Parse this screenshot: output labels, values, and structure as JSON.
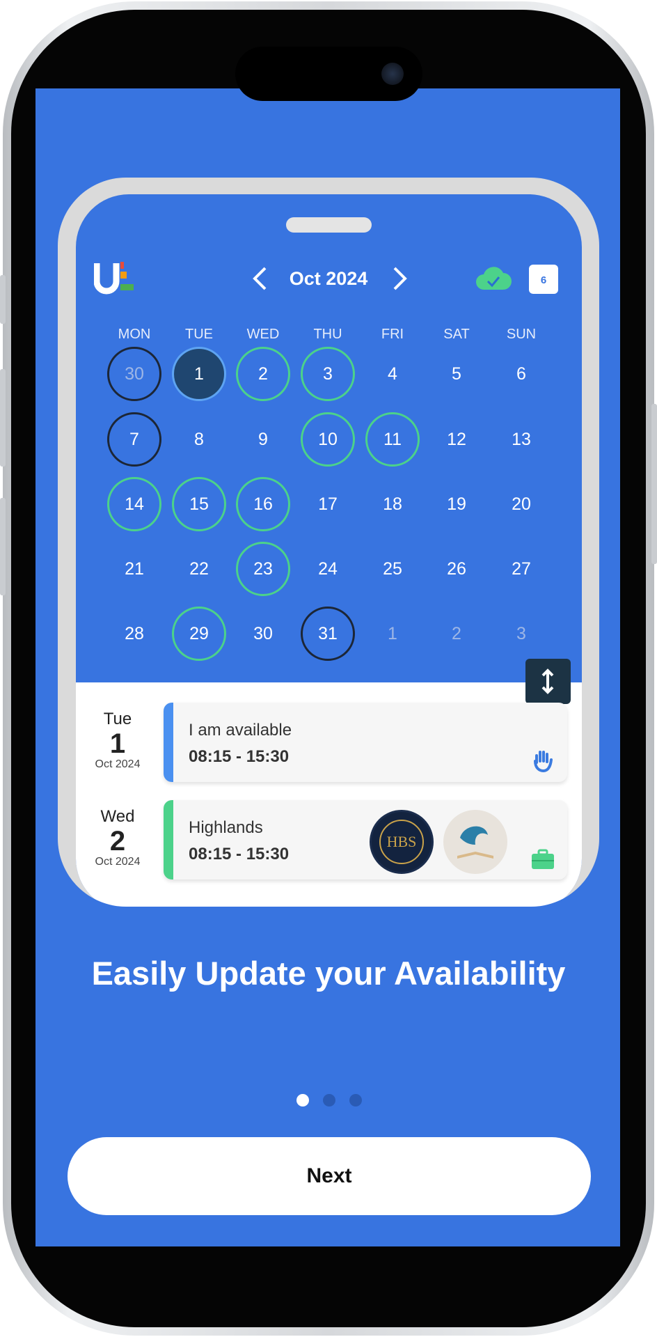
{
  "header": {
    "month": "Oct 2024",
    "calendar_badge": "6"
  },
  "weekdays": [
    "MON",
    "TUE",
    "WED",
    "THU",
    "FRI",
    "SAT",
    "SUN"
  ],
  "weeks": [
    [
      {
        "d": "30",
        "s": "out dark"
      },
      {
        "d": "1",
        "s": "today"
      },
      {
        "d": "2",
        "s": "green"
      },
      {
        "d": "3",
        "s": "green"
      },
      {
        "d": "4",
        "s": ""
      },
      {
        "d": "5",
        "s": ""
      },
      {
        "d": "6",
        "s": ""
      }
    ],
    [
      {
        "d": "7",
        "s": "dark"
      },
      {
        "d": "8",
        "s": ""
      },
      {
        "d": "9",
        "s": ""
      },
      {
        "d": "10",
        "s": "green"
      },
      {
        "d": "11",
        "s": "green"
      },
      {
        "d": "12",
        "s": ""
      },
      {
        "d": "13",
        "s": ""
      }
    ],
    [
      {
        "d": "14",
        "s": "green"
      },
      {
        "d": "15",
        "s": "green"
      },
      {
        "d": "16",
        "s": "green"
      },
      {
        "d": "17",
        "s": ""
      },
      {
        "d": "18",
        "s": ""
      },
      {
        "d": "19",
        "s": ""
      },
      {
        "d": "20",
        "s": ""
      }
    ],
    [
      {
        "d": "21",
        "s": ""
      },
      {
        "d": "22",
        "s": ""
      },
      {
        "d": "23",
        "s": "green"
      },
      {
        "d": "24",
        "s": ""
      },
      {
        "d": "25",
        "s": ""
      },
      {
        "d": "26",
        "s": ""
      },
      {
        "d": "27",
        "s": ""
      }
    ],
    [
      {
        "d": "28",
        "s": ""
      },
      {
        "d": "29",
        "s": "green"
      },
      {
        "d": "30",
        "s": ""
      },
      {
        "d": "31",
        "s": "dark"
      },
      {
        "d": "1",
        "s": "out"
      },
      {
        "d": "2",
        "s": "out"
      },
      {
        "d": "3",
        "s": "out"
      }
    ]
  ],
  "events": [
    {
      "weekday": "Tue",
      "day": "1",
      "month": "Oct 2024",
      "title": "I am available",
      "time": "08:15 - 15:30",
      "color": "#4a90f0",
      "icon": "hand-icon"
    },
    {
      "weekday": "Wed",
      "day": "2",
      "month": "Oct 2024",
      "title": "Highlands",
      "time": "08:15 - 15:30",
      "color": "#4cd28a",
      "icon": "briefcase-icon",
      "avatars": [
        "HBS"
      ]
    }
  ],
  "headline": "Easily Update your Availability",
  "pagination": {
    "total": 3,
    "active": 0
  },
  "next_label": "Next",
  "colors": {
    "background": "#3874e0",
    "available": "#4cd28a",
    "today": "#1f4670"
  }
}
